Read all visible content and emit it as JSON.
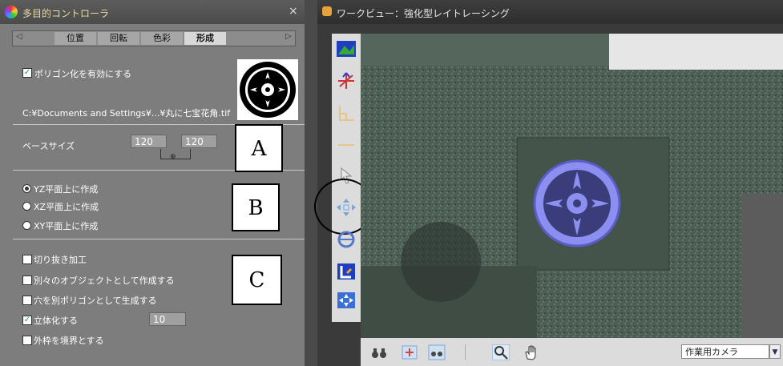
{
  "left_panel": {
    "title": "多目的コントローラ",
    "close_glyph": "×",
    "tabs": [
      "位置",
      "回転",
      "色彩",
      "形成"
    ],
    "active_tab": "形成",
    "tab_left_arrow": "◁",
    "tab_right_arrow": "▷",
    "polygon_checkbox_label": "ポリゴン化を有効にする",
    "file_path": "C:¥Documents and Settings¥...¥丸に七宝花角.tif",
    "base_size_label": "ベースサイズ",
    "base_size_w": "120",
    "base_size_h": "120",
    "link_glyph": "⊕",
    "radios": [
      {
        "label": "YZ平面上に作成",
        "selected": true
      },
      {
        "label": "XZ平面上に作成",
        "selected": false
      },
      {
        "label": "XY平面上に作成",
        "selected": false
      }
    ],
    "options": [
      {
        "label": "切り抜き加工",
        "checked": false
      },
      {
        "label": "別々のオブジェクトとして作成する",
        "checked": false
      },
      {
        "label": "穴を別ポリゴンとして生成する",
        "checked": false
      },
      {
        "label": "立体化する",
        "checked": true
      },
      {
        "label": "外枠を境界とする",
        "checked": false
      }
    ],
    "extrude_value": "10"
  },
  "annotations": [
    "A",
    "B",
    "C"
  ],
  "right_panel": {
    "title": "ワークビュー：強化型レイトレーシング",
    "camera_select": "作業用カメラ",
    "dropdown_glyph": "▼"
  },
  "colors": {
    "panel_bg": "#7d7d7d",
    "crest_blue": "#8c8ff0",
    "stone_green": "#4a5a50"
  }
}
